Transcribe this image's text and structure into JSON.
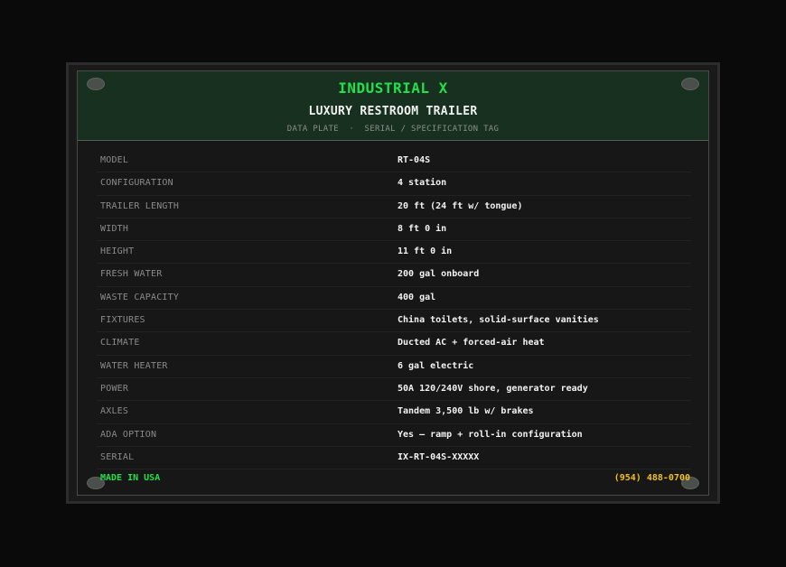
{
  "header": {
    "brand": "INDUSTRIAL X",
    "subtitle": "LUXURY RESTROOM TRAILER",
    "tagline": "DATA PLATE  ·  SERIAL / SPECIFICATION TAG"
  },
  "specs": [
    {
      "label": "MODEL",
      "value": "RT-04S"
    },
    {
      "label": "CONFIGURATION",
      "value": "4 station"
    },
    {
      "label": "TRAILER LENGTH",
      "value": "20 ft (24 ft w/ tongue)"
    },
    {
      "label": "WIDTH",
      "value": "8 ft 0 in"
    },
    {
      "label": "HEIGHT",
      "value": "11 ft 0 in"
    },
    {
      "label": "FRESH WATER",
      "value": "200 gal onboard"
    },
    {
      "label": "WASTE CAPACITY",
      "value": "400 gal"
    },
    {
      "label": "FIXTURES",
      "value": "China toilets, solid-surface vanities"
    },
    {
      "label": "CLIMATE",
      "value": "Ducted AC + forced-air heat"
    },
    {
      "label": "WATER HEATER",
      "value": "6 gal electric"
    },
    {
      "label": "POWER",
      "value": "50A 120/240V shore, generator ready"
    },
    {
      "label": "AXLES",
      "value": "Tandem 3,500 lb w/ brakes"
    },
    {
      "label": "ADA OPTION",
      "value": "Yes — ramp + roll-in configuration"
    },
    {
      "label": "SERIAL",
      "value": "IX-RT-04S-XXXXX"
    }
  ],
  "footer": {
    "origin": "MADE IN USA",
    "phone": "(954) 488-0700"
  },
  "colors": {
    "brand_green": "#22e04a",
    "phone_yellow": "#f0c020",
    "header_bg": "#173020"
  }
}
